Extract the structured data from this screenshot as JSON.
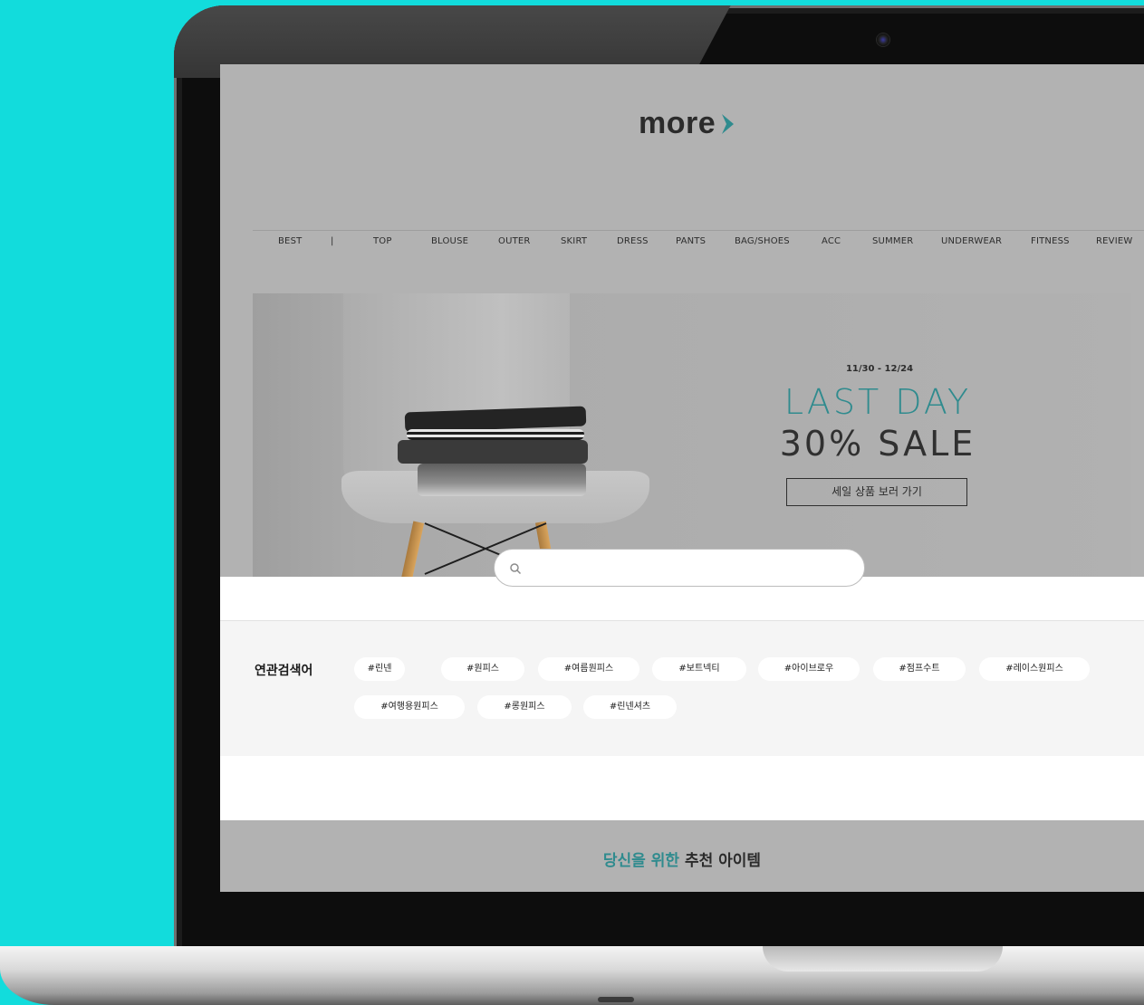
{
  "brand": {
    "logo_text": "more",
    "accent_color": "#2f8b8e",
    "background_color": "#12dcdc"
  },
  "nav": {
    "items": [
      "BEST",
      "|",
      "TOP",
      "BLOUSE",
      "OUTER",
      "SKIRT",
      "DRESS",
      "PANTS",
      "BAG/SHOES",
      "ACC",
      "SUMMER",
      "UNDERWEAR",
      "FITNESS",
      "REVIEW"
    ]
  },
  "banner": {
    "date_range": "11/30 - 12/24",
    "headline_1": "LAST DAY",
    "headline_2": "30% SALE",
    "button_label": "세일 상품 보러 가기"
  },
  "search": {
    "placeholder": "",
    "value": "",
    "icon": "search-icon"
  },
  "related": {
    "title": "연관검색어",
    "tags": [
      "#린넨",
      "#원피스",
      "#여름원피스",
      "#보트넥티",
      "#아이브로우",
      "#점프수트",
      "#레이스원피스",
      "#여행용원피스",
      "#롱원피스",
      "#린넨셔츠"
    ]
  },
  "recommend": {
    "title_accent": "당신을 위한",
    "title_rest": "추천 아이템"
  }
}
